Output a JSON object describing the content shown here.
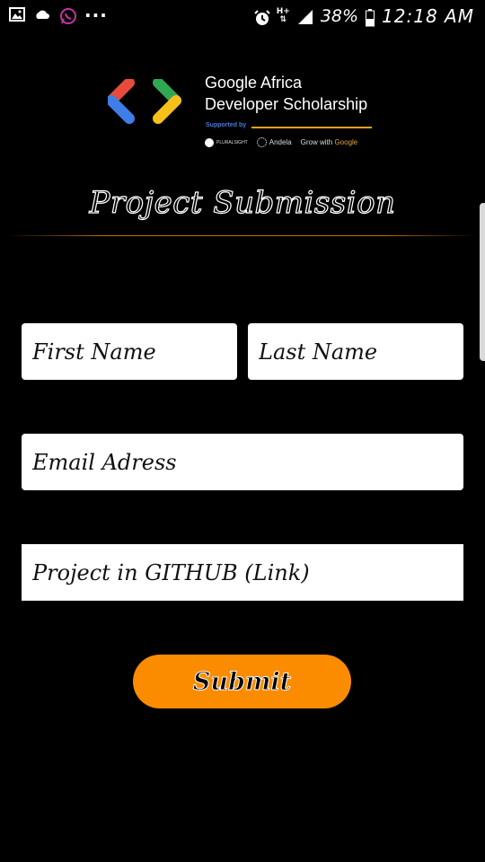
{
  "status_bar": {
    "left_icons": [
      "image-icon",
      "cloud-icon",
      "whatsapp-icon"
    ],
    "more": "...",
    "network": "H+",
    "battery": "38%",
    "time": "12:18 AM"
  },
  "logo": {
    "line1": "Google Africa",
    "line2": "Developer Scholarship",
    "supported_by": "Supported by",
    "partners": [
      "PLURALSIGHT",
      "Andela",
      "Grow with Google"
    ]
  },
  "title": "Project Submission",
  "form": {
    "first_name_placeholder": "First Name",
    "last_name_placeholder": "Last Name",
    "email_placeholder": "Email Adress",
    "github_placeholder": "Project in GITHUB (Link)",
    "submit_label": "Submit"
  },
  "colors": {
    "background": "#000000",
    "accent": "#fb8c00",
    "divider": "#c96d0c"
  }
}
